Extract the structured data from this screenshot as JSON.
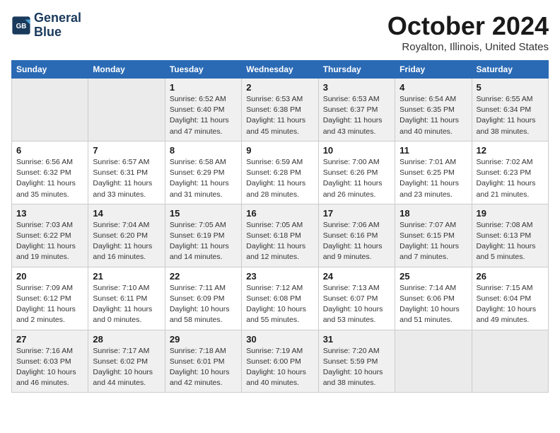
{
  "header": {
    "logo_line1": "General",
    "logo_line2": "Blue",
    "month": "October 2024",
    "location": "Royalton, Illinois, United States"
  },
  "weekdays": [
    "Sunday",
    "Monday",
    "Tuesday",
    "Wednesday",
    "Thursday",
    "Friday",
    "Saturday"
  ],
  "weeks": [
    [
      {
        "day": "",
        "info": ""
      },
      {
        "day": "",
        "info": ""
      },
      {
        "day": "1",
        "info": "Sunrise: 6:52 AM\nSunset: 6:40 PM\nDaylight: 11 hours and 47 minutes."
      },
      {
        "day": "2",
        "info": "Sunrise: 6:53 AM\nSunset: 6:38 PM\nDaylight: 11 hours and 45 minutes."
      },
      {
        "day": "3",
        "info": "Sunrise: 6:53 AM\nSunset: 6:37 PM\nDaylight: 11 hours and 43 minutes."
      },
      {
        "day": "4",
        "info": "Sunrise: 6:54 AM\nSunset: 6:35 PM\nDaylight: 11 hours and 40 minutes."
      },
      {
        "day": "5",
        "info": "Sunrise: 6:55 AM\nSunset: 6:34 PM\nDaylight: 11 hours and 38 minutes."
      }
    ],
    [
      {
        "day": "6",
        "info": "Sunrise: 6:56 AM\nSunset: 6:32 PM\nDaylight: 11 hours and 35 minutes."
      },
      {
        "day": "7",
        "info": "Sunrise: 6:57 AM\nSunset: 6:31 PM\nDaylight: 11 hours and 33 minutes."
      },
      {
        "day": "8",
        "info": "Sunrise: 6:58 AM\nSunset: 6:29 PM\nDaylight: 11 hours and 31 minutes."
      },
      {
        "day": "9",
        "info": "Sunrise: 6:59 AM\nSunset: 6:28 PM\nDaylight: 11 hours and 28 minutes."
      },
      {
        "day": "10",
        "info": "Sunrise: 7:00 AM\nSunset: 6:26 PM\nDaylight: 11 hours and 26 minutes."
      },
      {
        "day": "11",
        "info": "Sunrise: 7:01 AM\nSunset: 6:25 PM\nDaylight: 11 hours and 23 minutes."
      },
      {
        "day": "12",
        "info": "Sunrise: 7:02 AM\nSunset: 6:23 PM\nDaylight: 11 hours and 21 minutes."
      }
    ],
    [
      {
        "day": "13",
        "info": "Sunrise: 7:03 AM\nSunset: 6:22 PM\nDaylight: 11 hours and 19 minutes."
      },
      {
        "day": "14",
        "info": "Sunrise: 7:04 AM\nSunset: 6:20 PM\nDaylight: 11 hours and 16 minutes."
      },
      {
        "day": "15",
        "info": "Sunrise: 7:05 AM\nSunset: 6:19 PM\nDaylight: 11 hours and 14 minutes."
      },
      {
        "day": "16",
        "info": "Sunrise: 7:05 AM\nSunset: 6:18 PM\nDaylight: 11 hours and 12 minutes."
      },
      {
        "day": "17",
        "info": "Sunrise: 7:06 AM\nSunset: 6:16 PM\nDaylight: 11 hours and 9 minutes."
      },
      {
        "day": "18",
        "info": "Sunrise: 7:07 AM\nSunset: 6:15 PM\nDaylight: 11 hours and 7 minutes."
      },
      {
        "day": "19",
        "info": "Sunrise: 7:08 AM\nSunset: 6:13 PM\nDaylight: 11 hours and 5 minutes."
      }
    ],
    [
      {
        "day": "20",
        "info": "Sunrise: 7:09 AM\nSunset: 6:12 PM\nDaylight: 11 hours and 2 minutes."
      },
      {
        "day": "21",
        "info": "Sunrise: 7:10 AM\nSunset: 6:11 PM\nDaylight: 11 hours and 0 minutes."
      },
      {
        "day": "22",
        "info": "Sunrise: 7:11 AM\nSunset: 6:09 PM\nDaylight: 10 hours and 58 minutes."
      },
      {
        "day": "23",
        "info": "Sunrise: 7:12 AM\nSunset: 6:08 PM\nDaylight: 10 hours and 55 minutes."
      },
      {
        "day": "24",
        "info": "Sunrise: 7:13 AM\nSunset: 6:07 PM\nDaylight: 10 hours and 53 minutes."
      },
      {
        "day": "25",
        "info": "Sunrise: 7:14 AM\nSunset: 6:06 PM\nDaylight: 10 hours and 51 minutes."
      },
      {
        "day": "26",
        "info": "Sunrise: 7:15 AM\nSunset: 6:04 PM\nDaylight: 10 hours and 49 minutes."
      }
    ],
    [
      {
        "day": "27",
        "info": "Sunrise: 7:16 AM\nSunset: 6:03 PM\nDaylight: 10 hours and 46 minutes."
      },
      {
        "day": "28",
        "info": "Sunrise: 7:17 AM\nSunset: 6:02 PM\nDaylight: 10 hours and 44 minutes."
      },
      {
        "day": "29",
        "info": "Sunrise: 7:18 AM\nSunset: 6:01 PM\nDaylight: 10 hours and 42 minutes."
      },
      {
        "day": "30",
        "info": "Sunrise: 7:19 AM\nSunset: 6:00 PM\nDaylight: 10 hours and 40 minutes."
      },
      {
        "day": "31",
        "info": "Sunrise: 7:20 AM\nSunset: 5:59 PM\nDaylight: 10 hours and 38 minutes."
      },
      {
        "day": "",
        "info": ""
      },
      {
        "day": "",
        "info": ""
      }
    ]
  ]
}
